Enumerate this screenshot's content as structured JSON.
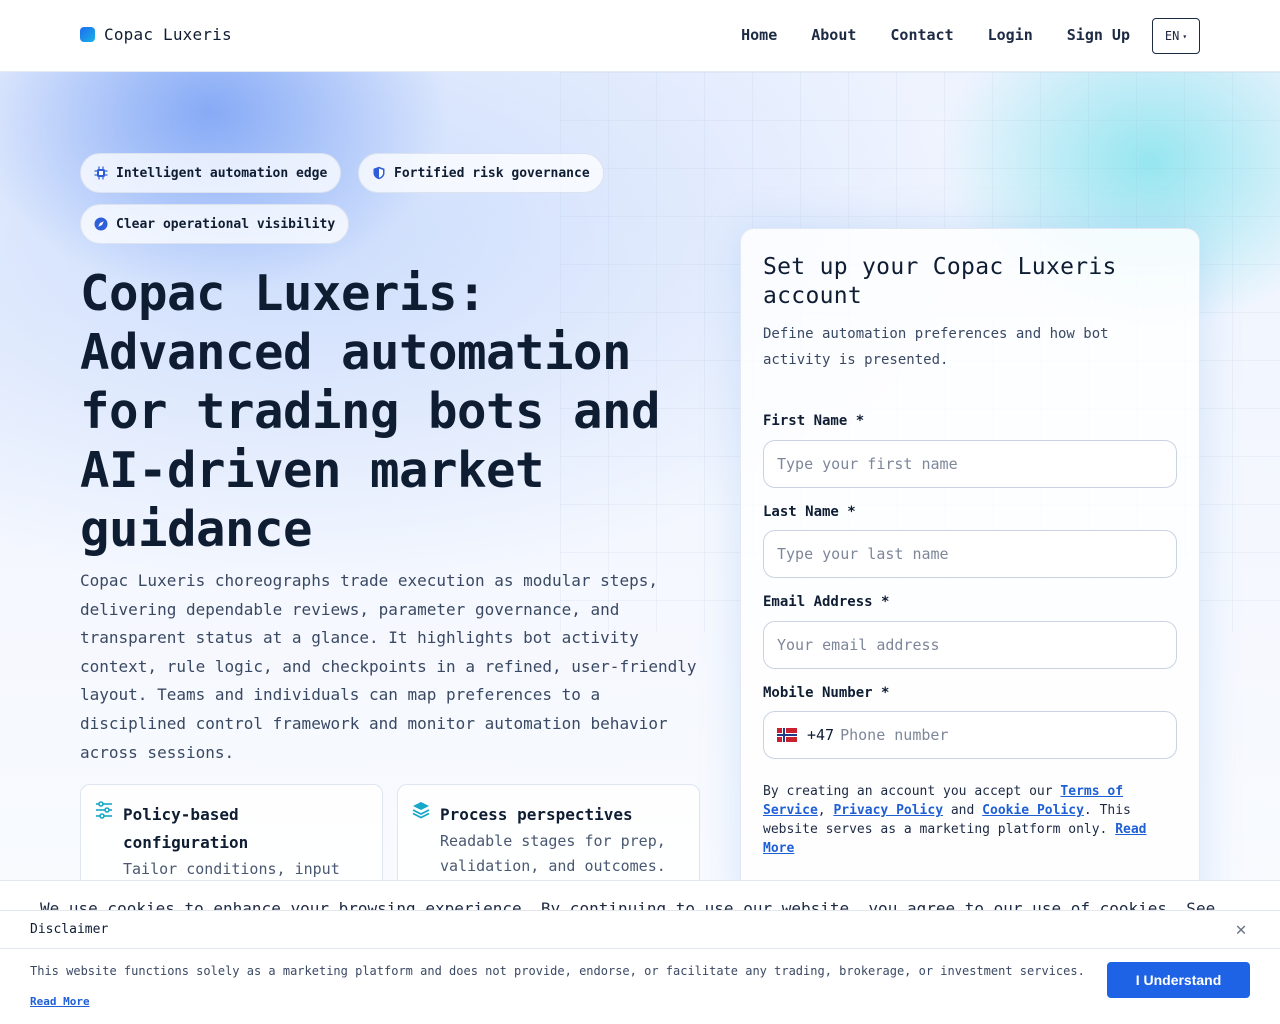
{
  "nav": {
    "brand": "Copac Luxeris",
    "links": [
      "Home",
      "About",
      "Contact",
      "Login",
      "Sign Up"
    ],
    "language": "EN"
  },
  "hero": {
    "pills": [
      {
        "label": "Intelligent automation edge",
        "icon": "cpu-icon"
      },
      {
        "label": "Fortified risk governance",
        "icon": "shield-icon"
      },
      {
        "label": "Clear operational visibility",
        "icon": "compass-icon"
      }
    ],
    "title": "Copac Luxeris: Advanced automation for trading bots and AI-driven market guidance",
    "description": "Copac Luxeris choreographs trade execution as modular steps, delivering dependable reviews, parameter governance, and transparent status at a glance. It highlights bot activity context, rule logic, and checkpoints in a refined, user-friendly layout. Teams and individuals can map preferences to a disciplined control framework and monitor automation behavior across sessions.",
    "features": [
      {
        "title": "Policy-based configuration",
        "text": "Tailor conditions, input",
        "icon": "sliders-icon"
      },
      {
        "title": "Process perspectives",
        "text": "Readable stages for prep, validation, and outcomes.",
        "icon": "layers-icon"
      }
    ]
  },
  "form": {
    "title": "Set up your Copac Luxeris account",
    "subtitle": "Define automation preferences and how bot activity is presented.",
    "first_name_label": "First Name *",
    "first_name_placeholder": "Type your first name",
    "last_name_label": "Last Name *",
    "last_name_placeholder": "Type your last name",
    "email_label": "Email Address *",
    "email_placeholder": "Your email address",
    "mobile_label": "Mobile Number *",
    "dial_code": "+47",
    "phone_placeholder": "Phone number",
    "terms": {
      "prefix": "By creating an account you accept our ",
      "tos": "Terms of Service",
      "sep1": ", ",
      "privacy": "Privacy Policy",
      "sep2": " and ",
      "cookie": "Cookie Policy",
      "suffix": ". This website serves as a marketing platform only. ",
      "read_more": "Read More"
    }
  },
  "cookie_banner": {
    "text": "We use cookies to enhance your browsing experience. By continuing to use our website, you agree to our use of cookies. See"
  },
  "disclaimer": {
    "title": "Disclaimer",
    "text": "This website functions solely as a marketing platform and does not provide, endorse, or facilitate any trading, brokerage, or investment services.",
    "read_more": "Read More",
    "button": "I Understand"
  },
  "colors": {
    "accent": "#1e63e6",
    "link": "#1f5fd6",
    "text": "#0f1d33"
  }
}
